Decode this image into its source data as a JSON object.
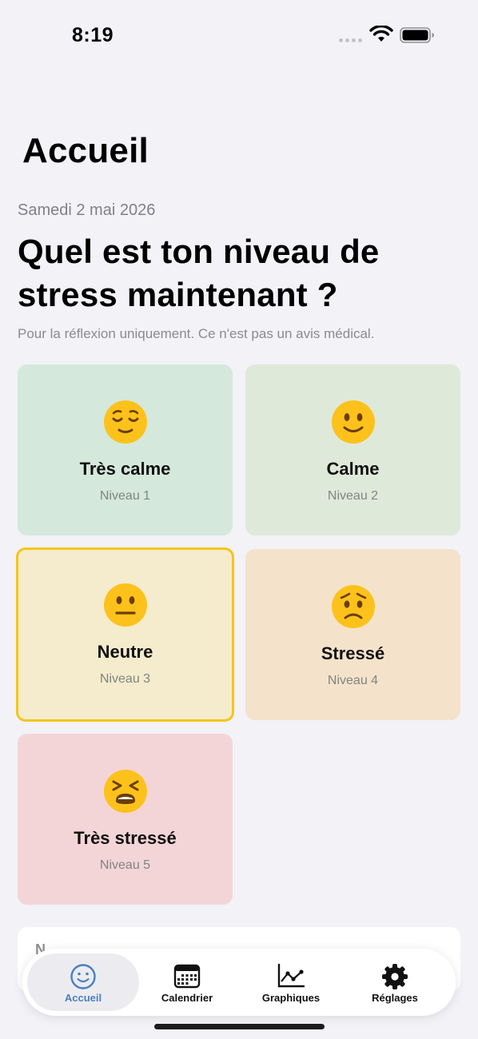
{
  "status_bar": {
    "time": "8:19"
  },
  "nav": {
    "title": "Accueil"
  },
  "header": {
    "date": "Samedi 2 mai 2026",
    "question": "Quel est ton niveau de stress maintenant ?",
    "disclaimer": "Pour la réflexion uniquement. Ce n'est pas un avis médical."
  },
  "moods": [
    {
      "label": "Très calme",
      "level": "Niveau 1",
      "emoji": "😌",
      "icon": "relieved-face-icon",
      "bg": "#d5e8dc",
      "selected": false
    },
    {
      "label": "Calme",
      "level": "Niveau 2",
      "emoji": "🙂",
      "icon": "slightly-smiling-face-icon",
      "bg": "#dfe9da",
      "selected": false
    },
    {
      "label": "Neutre",
      "level": "Niveau 3",
      "emoji": "😐",
      "icon": "neutral-face-icon",
      "bg": "#f5ebcd",
      "selected": true
    },
    {
      "label": "Stressé",
      "level": "Niveau 4",
      "emoji": "😟",
      "icon": "worried-face-icon",
      "bg": "#f4e3ca",
      "selected": false
    },
    {
      "label": "Très stressé",
      "level": "Niveau 5",
      "emoji": "😫",
      "icon": "tired-face-icon",
      "bg": "#f3d5d7",
      "selected": false
    }
  ],
  "tabs": [
    {
      "label": "Accueil",
      "icon": "smiley-icon",
      "active": true
    },
    {
      "label": "Calendrier",
      "icon": "calendar-icon",
      "active": false
    },
    {
      "label": "Graphiques",
      "icon": "chart-icon",
      "active": false
    },
    {
      "label": "Réglages",
      "icon": "gear-icon",
      "active": false
    }
  ],
  "colors": {
    "background": "#f2f2f7",
    "accent": "#4a7fc1",
    "selected_border": "#f5c518"
  }
}
